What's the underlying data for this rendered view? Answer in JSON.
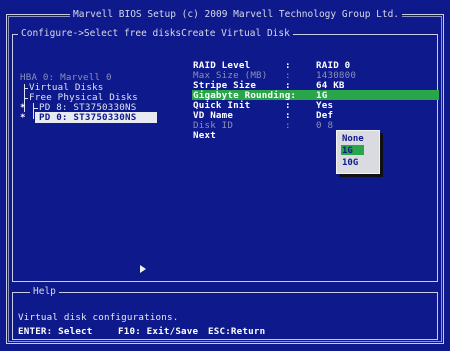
{
  "title": "Marvell BIOS Setup (c) 2009 Marvell Technology Group Ltd.",
  "breadcrumb": "Configure->Select free disksCreate Virtual Disk",
  "tree": {
    "hba": "HBA 0: Marvell 0",
    "virtual_disks": "Virtual Disks",
    "free_disks": "Free Physical Disks",
    "pd8": "PD 8: ST3750330NS",
    "pd0": "PD 0: ST3750330NS",
    "pd8_mark": "*",
    "pd0_mark": "*"
  },
  "fields": [
    {
      "label": "RAID Level",
      "sep": ":",
      "value": "RAID 0"
    },
    {
      "label": "Max Size (MB)",
      "sep": ":",
      "value": "1430800"
    },
    {
      "label": "Stripe Size",
      "sep": ":",
      "value": "64 KB"
    },
    {
      "label": "Gigabyte Rounding:",
      "sep": "",
      "value": "1G"
    },
    {
      "label": "Quick Init",
      "sep": ":",
      "value": "Yes"
    },
    {
      "label": "VD Name",
      "sep": ":",
      "value": "Def"
    },
    {
      "label": "Disk ID",
      "sep": ":",
      "value": "0 8"
    }
  ],
  "next_label": "Next",
  "popup": {
    "options": [
      "None",
      "1G",
      "10G"
    ],
    "selected": "1G"
  },
  "help": {
    "title": "Help",
    "description": "Virtual disk configurations.",
    "keys": [
      {
        "label": "ENTER: Select"
      },
      {
        "label": "F10: Exit/Save"
      },
      {
        "label": "ESC:Return"
      }
    ]
  },
  "colors": {
    "background": "#0e1a8c",
    "highlight": "#2aa64a",
    "selection": "#e8eaf2"
  }
}
